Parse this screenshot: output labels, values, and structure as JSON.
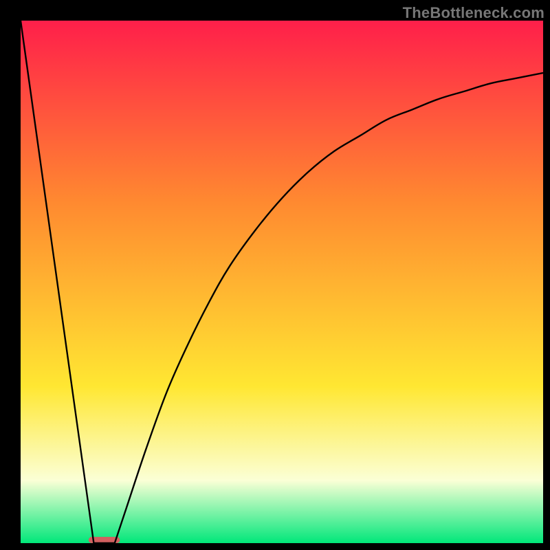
{
  "watermark": "TheBottleneck.com",
  "colors": {
    "frame": "#000000",
    "gradient_top": "#ff1f4a",
    "gradient_mid1": "#ff8a30",
    "gradient_mid2": "#ffe732",
    "gradient_pale": "#fbffd6",
    "gradient_bottom": "#00e77a",
    "curve": "#000000",
    "bar": "#d16060"
  },
  "chart_data": {
    "type": "line",
    "title": "",
    "xlabel": "",
    "ylabel": "",
    "ylim": [
      0,
      100
    ],
    "xlim": [
      0,
      100
    ],
    "series": [
      {
        "name": "left-edge",
        "x": [
          0,
          14
        ],
        "y": [
          100,
          0
        ]
      },
      {
        "name": "right-curve",
        "x": [
          18,
          20,
          24,
          28,
          32,
          36,
          40,
          45,
          50,
          55,
          60,
          65,
          70,
          75,
          80,
          85,
          90,
          95,
          100
        ],
        "y": [
          0,
          6,
          18,
          29,
          38,
          46,
          53,
          60,
          66,
          71,
          75,
          78,
          81,
          83,
          85,
          86.5,
          88,
          89,
          90
        ]
      }
    ],
    "bar": {
      "x_start": 13,
      "x_end": 19,
      "height_pct": 1.2
    },
    "gradient_stops": [
      {
        "pct": 0,
        "color": "#ff1f4a"
      },
      {
        "pct": 35,
        "color": "#ff8a30"
      },
      {
        "pct": 70,
        "color": "#ffe732"
      },
      {
        "pct": 88,
        "color": "#fbffd6"
      },
      {
        "pct": 100,
        "color": "#00e77a"
      }
    ]
  }
}
